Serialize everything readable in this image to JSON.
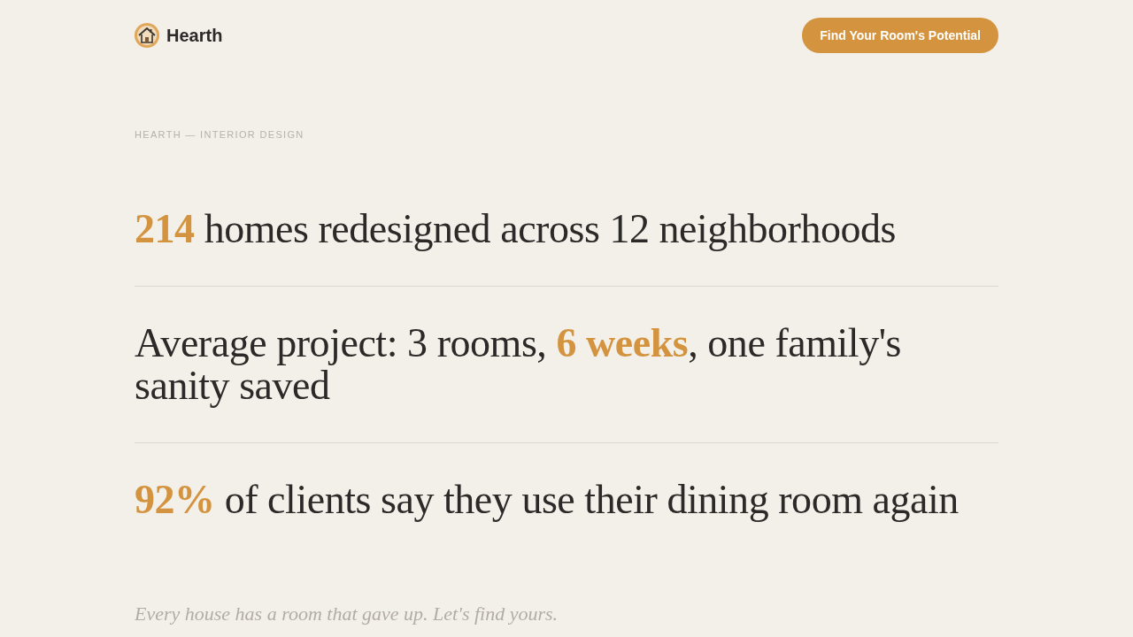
{
  "header": {
    "brand": "Hearth",
    "cta": "Find Your Room's Potential"
  },
  "eyebrow": "HEARTH — INTERIOR DESIGN",
  "stats": [
    "**214** homes redesigned across 12 neighborhoods",
    "Average project: 3 rooms, **6 weeks**, one family's sanity saved",
    "**92%** of clients say they use their dining room again"
  ],
  "tagline": "Every house has a room that gave up. Let's find yours."
}
